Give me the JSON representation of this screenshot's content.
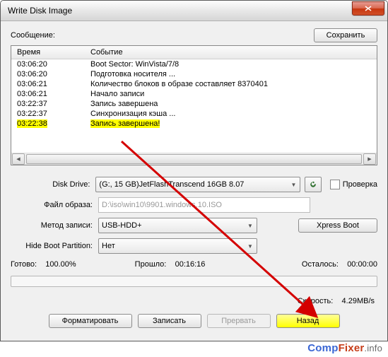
{
  "window": {
    "title": "Write Disk Image"
  },
  "message": {
    "label": "Сообщение:",
    "save_btn": "Сохранить"
  },
  "log": {
    "col_time": "Время",
    "col_event": "Событие",
    "rows": [
      {
        "t": "03:06:20",
        "e": "Boot Sector: WinVista/7/8",
        "hl": false
      },
      {
        "t": "03:06:20",
        "e": "Подготовка носителя ...",
        "hl": false
      },
      {
        "t": "03:06:21",
        "e": "Количество блоков в образе составляет 8370401",
        "hl": false
      },
      {
        "t": "03:06:21",
        "e": "Начало записи",
        "hl": false
      },
      {
        "t": "03:22:37",
        "e": "Запись завершена",
        "hl": false
      },
      {
        "t": "03:22:37",
        "e": "Синхронизация кэша ...",
        "hl": false
      },
      {
        "t": "03:22:38",
        "e": "Запись завершена!",
        "hl": true
      }
    ]
  },
  "form": {
    "disk_drive_label": "Disk Drive:",
    "disk_drive_value": "(G:, 15 GB)JetFlashTranscend 16GB  8.07",
    "check_label": "Проверка",
    "file_label": "Файл образа:",
    "file_value": "D:\\iso\\win10\\9901.windows.10.ISO",
    "method_label": "Метод записи:",
    "method_value": "USB-HDD+",
    "xpress_btn": "Xpress Boot",
    "hide_label": "Hide Boot Partition:",
    "hide_value": "Нет"
  },
  "status": {
    "ready_label": "Готово:",
    "ready_value": "100.00%",
    "elapsed_label": "Прошло:",
    "elapsed_value": "00:16:16",
    "remain_label": "Осталось:",
    "remain_value": "00:00:00",
    "speed_label": "Скорость:",
    "speed_value": "4.29MB/s"
  },
  "buttons": {
    "format": "Форматировать",
    "write": "Записать",
    "abort": "Прервать",
    "back": "Назад"
  },
  "watermark": {
    "p1": "Comp",
    "p2": "Fixer",
    "p3": ".info"
  }
}
